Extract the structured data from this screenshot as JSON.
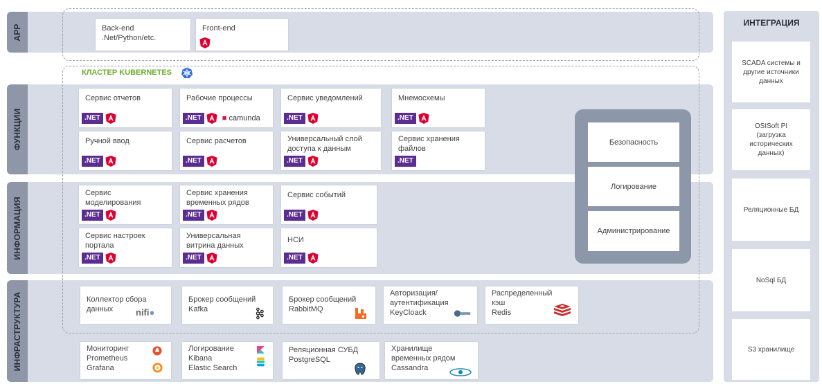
{
  "bands": {
    "app": "APP",
    "functions": "ФУНКЦИИ",
    "information": "ИНФОРМАЦИЯ",
    "infrastructure": "ИНФРАСТРУКТУРА"
  },
  "cluster_title": "КЛАСТЕР KUBERNETES",
  "app_cards": {
    "backend": "Back-end\n.Net/Python/etc.",
    "frontend": "Front-end"
  },
  "functions": {
    "reports": "Сервис отчетов",
    "workflows": "Рабочие процессы",
    "camunda": "camunda",
    "notifications": "Сервис уведомлений",
    "mnemo": "Мнемосхемы",
    "manual": "Ручной ввод",
    "calc": "Сервис расчетов",
    "dal": "Универсальный слой\nдоступа к данным",
    "files": "Сервис хранения\nфайлов"
  },
  "information": {
    "modeling": "Сервис\nмоделирования",
    "timeseries": "Сервис хранения\nвременных рядов",
    "events": "Сервис событий",
    "portal": "Сервис настроек\nпортала",
    "showcase": "Универсальная\nвитрина данных",
    "nsi": "НСИ"
  },
  "infra": {
    "collector": "Коллектор сбора\nданных",
    "kafka": "Брокер сообщений\nKafka",
    "rabbit": "Брокер сообщений\nRabbitMQ",
    "auth": "Авторизация/\nаутентификация\nKeyCloack",
    "redis": "Распределенный\nкэш\nRedis",
    "monitoring": "Мониторинг\nPrometheus\nGrafana",
    "logging": "Логирование\nKibana\nElastic Search",
    "postgres": "Реляционная СУБД\nPostgreSQL",
    "cassandra": "Хранилище\nвременных рядом\nCassandra"
  },
  "nifi_label": "nifi",
  "net_label": ".NET",
  "security": {
    "security": "Безопасность",
    "logging": "Логирование",
    "admin": "Администрирование"
  },
  "integration": {
    "title": "ИНТЕГРАЦИЯ",
    "scada": "SCADA системы и\nдругие источники\nданных",
    "osisoft": "OSISoft PI\n(загрузка\nисторических\nданных)",
    "rdb": "Реляционные БД",
    "nosql": "NoSql БД",
    "s3": "S3 хранилище"
  },
  "colors": {
    "band": "#d8dce6",
    "band_label": "#8f96a8",
    "net": "#5c2d91",
    "angular": "#dd0031",
    "kubernetes": "#326ce5",
    "cluster_title": "#6aab2c"
  }
}
